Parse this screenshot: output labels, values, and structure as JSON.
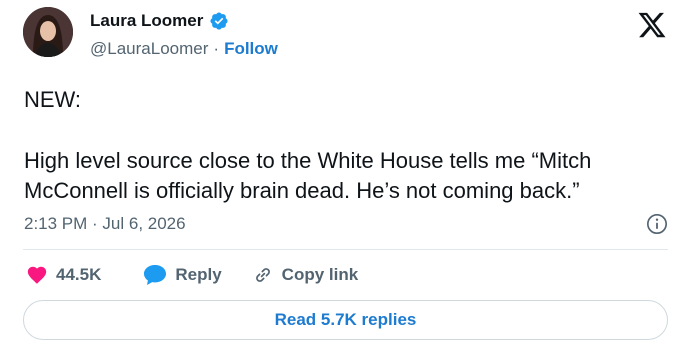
{
  "author": {
    "name": "Laura Loomer",
    "handle": "@LauraLoomer",
    "separator": "·",
    "follow_label": "Follow",
    "verified": true
  },
  "tweet": {
    "line1": "NEW:",
    "line2": "High level source close to the White House tells me “Mitch McConnell is officially brain dead. He’s not coming back.”",
    "timestamp": "2:13 PM · Jul 6, 2026"
  },
  "actions": {
    "likes": "44.5K",
    "reply_label": "Reply",
    "copy_link_label": "Copy link"
  },
  "read_replies_label": "Read 5.7K replies",
  "colors": {
    "accent": "#1d7bd0",
    "like": "#f91880",
    "reply": "#1d9bf0",
    "muted": "#536471",
    "text": "#0f1419"
  }
}
